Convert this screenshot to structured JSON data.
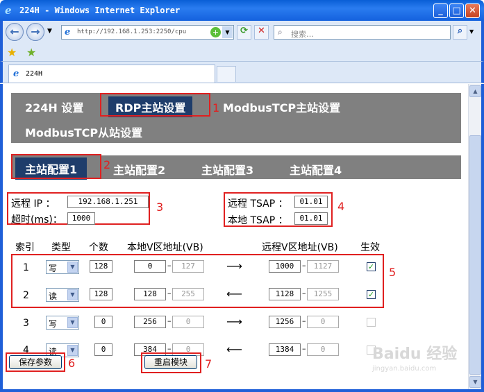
{
  "window": {
    "title": "224H - Windows Internet Explorer",
    "minimize": "_",
    "maximize": "□",
    "close": "✕"
  },
  "address_bar": {
    "url": "http://192.168.1.253:2250/cpu",
    "search_placeholder": "搜索…"
  },
  "browser_tab": {
    "label": "224H"
  },
  "main_nav": [
    "224H 设置",
    "RDP主站设置",
    "ModbusTCP主站设置",
    "ModbusTCP从站设置"
  ],
  "sub_nav": [
    "主站配置1",
    "主站配置2",
    "主站配置3",
    "主站配置4"
  ],
  "remote": {
    "ip_label": "远程 IP ：",
    "ip_value": "192.168.1.251",
    "timeout_label": "超时(ms)：",
    "timeout_value": "1000",
    "remote_tsap_label": "远程 TSAP ：",
    "remote_tsap_value": "01.01",
    "local_tsap_label": "本地 TSAP ：",
    "local_tsap_value": "01.01"
  },
  "table": {
    "headers": [
      "索引",
      "类型",
      "个数",
      "本地V区地址(VB)",
      "远程V区地址(VB)",
      "生效"
    ],
    "rows": [
      {
        "index": "1",
        "type": "写",
        "count": "128",
        "local_start": "0",
        "local_end": "127",
        "arrow": "⟶",
        "remote_start": "1000",
        "remote_end": "1127",
        "enabled": true
      },
      {
        "index": "2",
        "type": "读",
        "count": "128",
        "local_start": "128",
        "local_end": "255",
        "arrow": "⟵",
        "remote_start": "1128",
        "remote_end": "1255",
        "enabled": true
      },
      {
        "index": "3",
        "type": "写",
        "count": "0",
        "local_start": "256",
        "local_end": "0",
        "arrow": "⟶",
        "remote_start": "1256",
        "remote_end": "0",
        "enabled": false
      },
      {
        "index": "4",
        "type": "读",
        "count": "0",
        "local_start": "384",
        "local_end": "0",
        "arrow": "⟵",
        "remote_start": "1384",
        "remote_end": "0",
        "enabled": false
      }
    ]
  },
  "buttons": {
    "save": "保存参数",
    "restart": "重启模块"
  },
  "annotations": [
    "1",
    "2",
    "3",
    "4",
    "5",
    "6",
    "7"
  ],
  "watermark": {
    "brand": "Baidu 经验",
    "url": "jingyan.baidu.com"
  },
  "colors": {
    "annotation": "#e02020",
    "nav_bg": "#808080",
    "nav_active": "#1f3d6b"
  }
}
